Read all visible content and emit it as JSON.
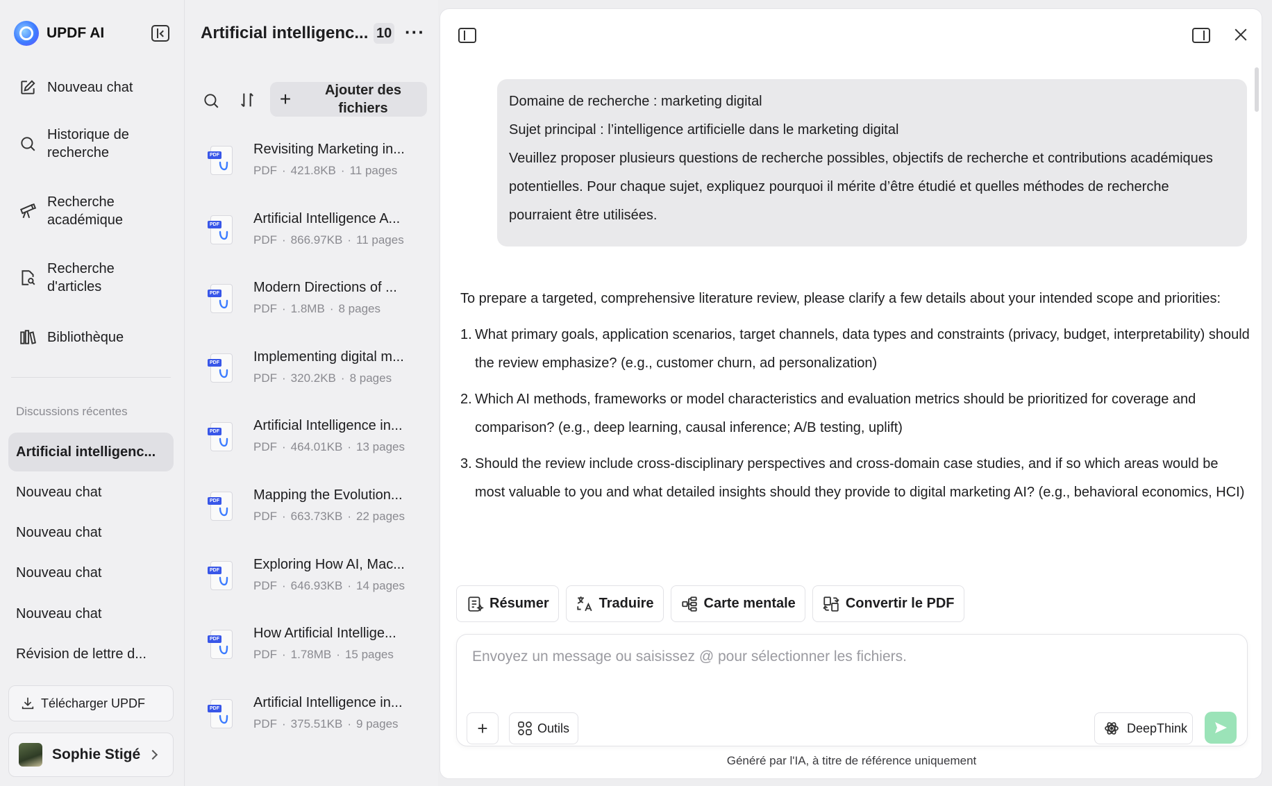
{
  "sidebar": {
    "brand": "UPDF AI",
    "nav": [
      {
        "label": "Nouveau chat",
        "icon": "new-chat-icon"
      },
      {
        "label": "Historique de recherche",
        "icon": "search-icon"
      },
      {
        "label": "Recherche académique",
        "icon": "telescope-icon"
      },
      {
        "label": "Recherche d'articles",
        "icon": "article-search-icon"
      },
      {
        "label": "Bibliothèque",
        "icon": "library-icon"
      }
    ],
    "recent_title": "Discussions récentes",
    "recent": [
      "Artificial intelligenc...",
      "Nouveau chat",
      "Nouveau chat",
      "Nouveau chat",
      "Nouveau chat",
      "Révision de lettre d..."
    ],
    "download_label": "Télécharger UPDF",
    "user_name": "Sophie Stigé"
  },
  "files": {
    "title": "Artificial intelligenc...",
    "count": "10",
    "more": "···",
    "add_label": "Ajouter des fichiers",
    "items": [
      {
        "name": "Revisiting Marketing in...",
        "type": "PDF",
        "size": "421.8KB",
        "pages": "11 pages"
      },
      {
        "name": "Artificial Intelligence A...",
        "type": "PDF",
        "size": "866.97KB",
        "pages": "11 pages"
      },
      {
        "name": "Modern Directions of ...",
        "type": "PDF",
        "size": "1.8MB",
        "pages": "8 pages"
      },
      {
        "name": "Implementing digital m...",
        "type": "PDF",
        "size": "320.2KB",
        "pages": "8 pages"
      },
      {
        "name": "Artificial Intelligence in...",
        "type": "PDF",
        "size": "464.01KB",
        "pages": "13 pages"
      },
      {
        "name": "Mapping the Evolution...",
        "type": "PDF",
        "size": "663.73KB",
        "pages": "22 pages"
      },
      {
        "name": "Exploring How AI, Mac...",
        "type": "PDF",
        "size": "646.93KB",
        "pages": "14 pages"
      },
      {
        "name": "How Artificial Intellige...",
        "type": "PDF",
        "size": "1.78MB",
        "pages": "15 pages"
      },
      {
        "name": "Artificial Intelligence in...",
        "type": "PDF",
        "size": "375.51KB",
        "pages": "9 pages"
      }
    ]
  },
  "chat": {
    "user_message": [
      "Domaine de recherche : marketing digital",
      "Sujet principal : l’intelligence artificielle dans le marketing digital",
      "Veuillez proposer plusieurs questions de recherche possibles, objectifs de recherche et contributions académiques potentielles. Pour chaque sujet, expliquez pourquoi il mérite d’être étudié et quelles méthodes de recherche pourraient être utilisées."
    ],
    "answer_intro": "To prepare a targeted, comprehensive literature review, please clarify a few details about your intended scope and priorities:",
    "answer_questions": [
      {
        "num": "1.",
        "text": "What primary goals, application scenarios, target channels, data types and constraints (privacy, budget, interpretability) should the review emphasize? (e.g., customer churn, ad personalization)"
      },
      {
        "num": "2.",
        "text": "Which AI methods, frameworks or model characteristics and evaluation metrics should be prioritized for coverage and comparison? (e.g., deep learning, causal inference; A/B testing, uplift)"
      },
      {
        "num": "3.",
        "text": "Should the review include cross-disciplinary perspectives and cross-domain case studies, and if so which areas would be most valuable to you and what detailed insights should they provide to digital marketing AI? (e.g., behavioral economics, HCI)"
      }
    ],
    "actions": [
      {
        "label": "Résumer",
        "icon": "summarize-icon"
      },
      {
        "label": "Traduire",
        "icon": "translate-icon"
      },
      {
        "label": "Carte mentale",
        "icon": "mind-map-icon"
      },
      {
        "label": "Convertir le PDF",
        "icon": "convert-icon"
      }
    ],
    "input_placeholder": "Envoyez un message ou saisissez @ pour sélectionner les fichiers.",
    "input_value": "",
    "tools_label": "Outils",
    "deepthink_label": "DeepThink",
    "footer_note": "Généré par l'IA, à titre de référence uniquement"
  },
  "colors": {
    "accent_send": "#9be3b8",
    "pdf_tag": "#3856e8",
    "cursor": "#0d7a3e"
  }
}
